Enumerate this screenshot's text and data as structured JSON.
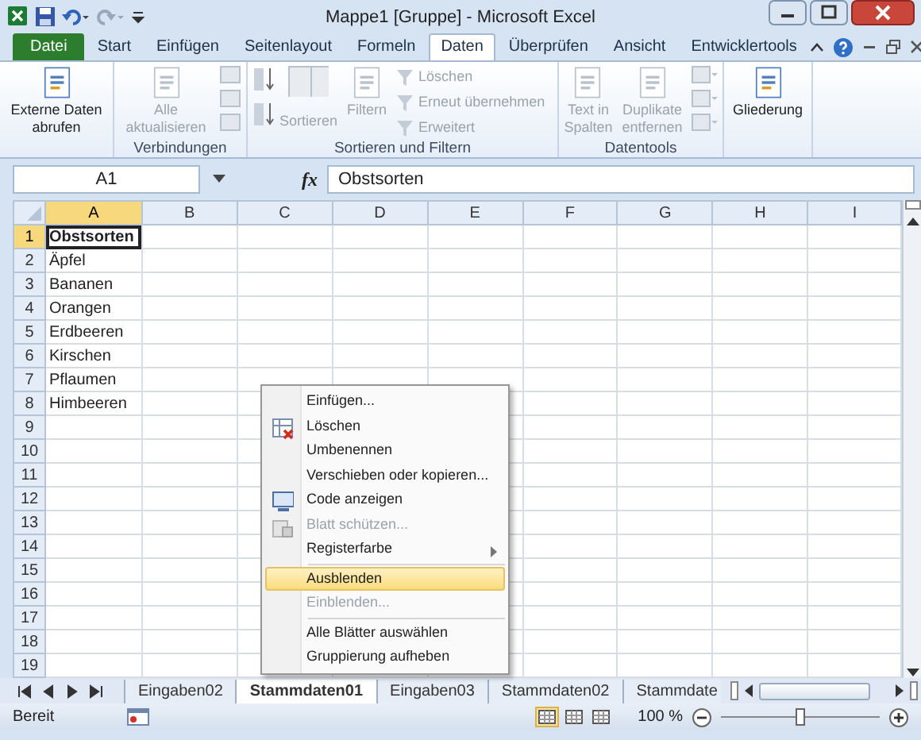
{
  "window": {
    "title": "Mappe1  [Gruppe]  -  Microsoft Excel"
  },
  "ribbon_tabs": [
    {
      "label": "Datei",
      "kind": "file",
      "selected": false
    },
    {
      "label": "Start",
      "kind": "tab",
      "selected": false
    },
    {
      "label": "Einfügen",
      "kind": "tab",
      "selected": false
    },
    {
      "label": "Seitenlayout",
      "kind": "tab",
      "selected": false
    },
    {
      "label": "Formeln",
      "kind": "tab",
      "selected": false
    },
    {
      "label": "Daten",
      "kind": "tab",
      "selected": true
    },
    {
      "label": "Überprüfen",
      "kind": "tab",
      "selected": false
    },
    {
      "label": "Ansicht",
      "kind": "tab",
      "selected": false
    },
    {
      "label": "Entwicklertools",
      "kind": "tab",
      "selected": false
    }
  ],
  "ribbon_groups": [
    {
      "items": [
        {
          "label": "Externe Daten abrufen",
          "kind": "large",
          "disabled": false
        }
      ]
    },
    {
      "label": "Verbindungen",
      "items": [
        {
          "label": "Alle aktualisieren",
          "kind": "large",
          "disabled": true
        }
      ]
    },
    {
      "label": "Sortieren und Filtern",
      "items": [
        {
          "label": "Sortieren",
          "kind": "sort",
          "disabled": true
        },
        {
          "label": "Filtern",
          "kind": "large",
          "disabled": true
        },
        {
          "label": "Löschen",
          "kind": "small",
          "disabled": true
        },
        {
          "label": "Erneut übernehmen",
          "kind": "small",
          "disabled": true
        },
        {
          "label": "Erweitert",
          "kind": "small",
          "disabled": true
        }
      ]
    },
    {
      "label": "Datentools",
      "items": [
        {
          "label": "Text in Spalten",
          "kind": "large",
          "disabled": true
        },
        {
          "label": "Duplikate entfernen",
          "kind": "large",
          "disabled": true
        }
      ]
    },
    {
      "items": [
        {
          "label": "Gliederung",
          "kind": "large",
          "disabled": false
        }
      ]
    }
  ],
  "formula_bar": {
    "name_box": "A1",
    "function_label": "fx",
    "value": "Obstsorten"
  },
  "columns": [
    {
      "label": "A",
      "selected": true
    },
    {
      "label": "B",
      "selected": false
    },
    {
      "label": "C",
      "selected": false
    },
    {
      "label": "D",
      "selected": false
    },
    {
      "label": "E",
      "selected": false
    },
    {
      "label": "F",
      "selected": false
    },
    {
      "label": "G",
      "selected": false
    },
    {
      "label": "H",
      "selected": false
    },
    {
      "label": "I",
      "selected": false
    }
  ],
  "rows": [
    {
      "label": "1",
      "selected": true,
      "cell": "Obstsorten",
      "bold": true
    },
    {
      "label": "2",
      "selected": false,
      "cell": "Äpfel",
      "bold": false
    },
    {
      "label": "3",
      "selected": false,
      "cell": "Bananen",
      "bold": false
    },
    {
      "label": "4",
      "selected": false,
      "cell": "Orangen",
      "bold": false
    },
    {
      "label": "5",
      "selected": false,
      "cell": "Erdbeeren",
      "bold": false
    },
    {
      "label": "6",
      "selected": false,
      "cell": "Kirschen",
      "bold": false
    },
    {
      "label": "7",
      "selected": false,
      "cell": "Pflaumen",
      "bold": false
    },
    {
      "label": "8",
      "selected": false,
      "cell": "Himbeeren",
      "bold": false
    },
    {
      "label": "9",
      "selected": false
    },
    {
      "label": "10",
      "selected": false
    },
    {
      "label": "11",
      "selected": false
    },
    {
      "label": "12",
      "selected": false
    },
    {
      "label": "13",
      "selected": false
    },
    {
      "label": "14",
      "selected": false
    },
    {
      "label": "15",
      "selected": false
    },
    {
      "label": "16",
      "selected": false
    },
    {
      "label": "17",
      "selected": false
    },
    {
      "label": "18",
      "selected": false
    },
    {
      "label": "19",
      "selected": false
    }
  ],
  "context_menu": [
    {
      "label": "Einfügen...",
      "disabled": false,
      "selected": false
    },
    {
      "label": "Löschen",
      "disabled": false,
      "selected": false,
      "kind": "delete"
    },
    {
      "label": "Umbenennen",
      "disabled": false,
      "selected": false
    },
    {
      "label": "Verschieben oder kopieren...",
      "disabled": false,
      "selected": false
    },
    {
      "label": "Code anzeigen",
      "disabled": false,
      "selected": false,
      "kind": "code"
    },
    {
      "label": "Blatt schützen...",
      "disabled": true,
      "selected": false,
      "kind": "protect"
    },
    {
      "label": "Registerfarbe",
      "disabled": false,
      "selected": false,
      "submenu": true
    },
    {
      "label": "Ausblenden",
      "disabled": false,
      "selected": true,
      "separator_before": true
    },
    {
      "label": "Einblenden...",
      "disabled": true,
      "selected": false
    },
    {
      "label": "Alle Blätter auswählen",
      "disabled": false,
      "selected": false,
      "separator_before": true
    },
    {
      "label": "Gruppierung aufheben",
      "disabled": false,
      "selected": false
    }
  ],
  "sheet_tabs": [
    {
      "label": "Eingaben02",
      "selected": false
    },
    {
      "label": "Stammdaten01",
      "selected": true
    },
    {
      "label": "Eingaben03",
      "selected": false
    },
    {
      "label": "Stammdaten02",
      "selected": false
    },
    {
      "label": "Stammdate",
      "selected": false
    }
  ],
  "status_bar": {
    "text": "Bereit",
    "zoom": "100 %",
    "level": 0.5
  }
}
